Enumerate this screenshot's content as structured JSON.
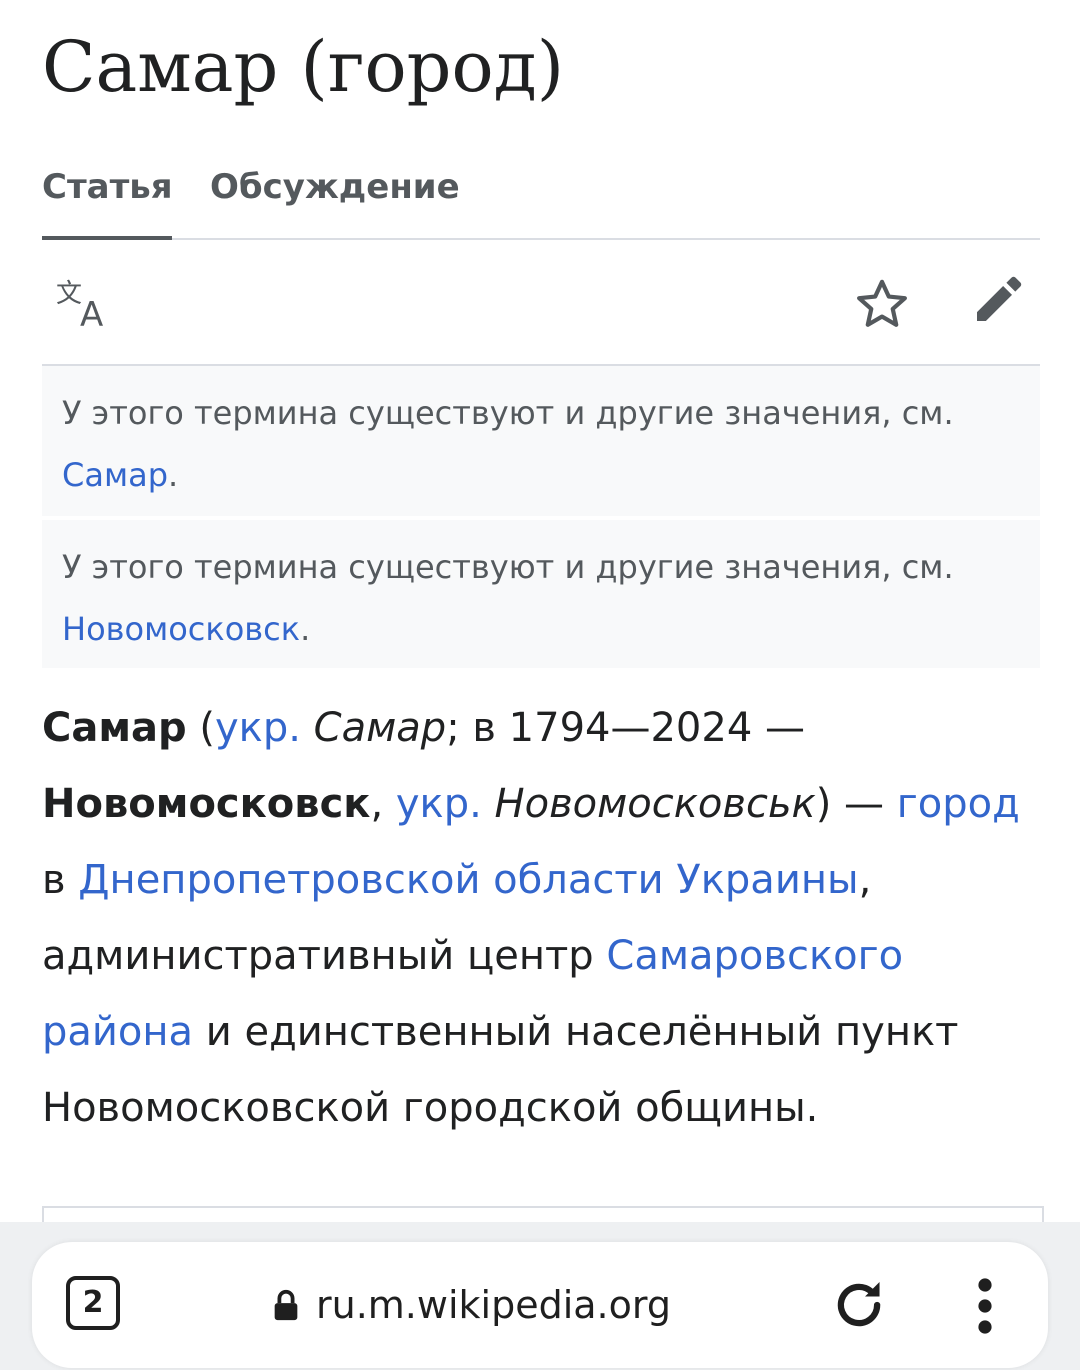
{
  "article": {
    "title": "Самар (город)"
  },
  "tabs": [
    {
      "label": "Статья",
      "active": true
    },
    {
      "label": "Обсуждение",
      "active": false
    }
  ],
  "toolbar": {
    "language_icon": "translate-icon",
    "watch_icon": "star-icon",
    "edit_icon": "pencil-icon"
  },
  "hatnotes": [
    {
      "text": "У этого термина существуют и другие значения, см. ",
      "link": "Самар",
      "end": "."
    },
    {
      "text": "У этого термина существуют и другие значения, см. ",
      "link": "Новомосковск",
      "end": "."
    }
  ],
  "lead": {
    "name_bold": "Самар",
    "p1": " (",
    "lang1": "укр.",
    "ukr_name1": "Самар",
    "p2": "; в 1794—2024 — ",
    "old_name_bold": "Новомосковск",
    "p3": ", ",
    "lang2": "укр.",
    "ukr_name2": "Новомосковськ",
    "p4": ") — ",
    "link_city": "город",
    "p5": " в ",
    "link_oblast": "Днепропетровской области Украины",
    "p6": ", административный центр ",
    "link_raion": "Самаровского района",
    "p7": " и единственный населённый пункт Новомосковской городской общины."
  },
  "browser": {
    "tab_count": "2",
    "url": "ru.m.wikipedia.org"
  },
  "colors": {
    "link": "#3366cc",
    "text": "#202122",
    "muted": "#54595d",
    "hatnote_bg": "#f8f9fa"
  }
}
